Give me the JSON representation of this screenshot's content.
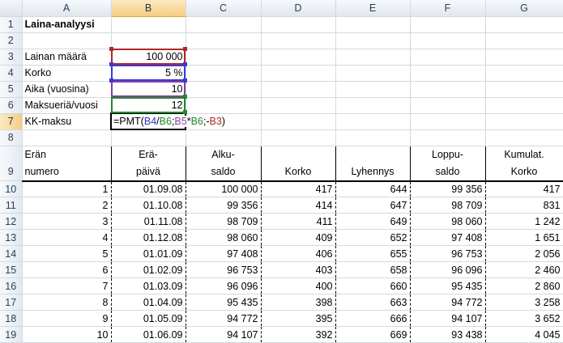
{
  "columns": [
    "A",
    "B",
    "C",
    "D",
    "E",
    "F",
    "G"
  ],
  "selected_column": "B",
  "rows": {
    "r1": {
      "num": "1",
      "a": "Laina-analyysi"
    },
    "r2": {
      "num": "2"
    },
    "r3": {
      "num": "3",
      "a": "Lainan määrä",
      "b": "100 000"
    },
    "r4": {
      "num": "4",
      "a": "Korko",
      "b": "5 %"
    },
    "r5": {
      "num": "5",
      "a": "Aika (vuosina)",
      "b": "10"
    },
    "r6": {
      "num": "6",
      "a": "Maksueriä/vuosi",
      "b": "12"
    },
    "r7": {
      "num": "7",
      "a": "KK-maksu"
    },
    "r8": {
      "num": "8"
    }
  },
  "formula": {
    "prefix": "=PMT(",
    "ref1": "B4",
    "sep1": "/",
    "ref2": "B6",
    "sep2": ";",
    "ref3": "B5",
    "sep3": "*",
    "ref4": "B6",
    "sep4": ";-",
    "ref5": "B3",
    "suffix": ")"
  },
  "table_header": {
    "num": "9",
    "a1": "Erän",
    "a2": "numero",
    "b1": "Erä-",
    "b2": "päivä",
    "c1": "Alku-",
    "c2": "saldo",
    "d2": "Korko",
    "e2": "Lyhennys",
    "f1": "Loppu-",
    "f2": "saldo",
    "g1": "Kumulat.",
    "g2": "Korko"
  },
  "data_rows": [
    {
      "num": "10",
      "era": "1",
      "paiva": "01.09.08",
      "alku": "100 000",
      "korko": "417",
      "lyh": "644",
      "loppu": "99 356",
      "kum": "417"
    },
    {
      "num": "11",
      "era": "2",
      "paiva": "01.10.08",
      "alku": "99 356",
      "korko": "414",
      "lyh": "647",
      "loppu": "98 709",
      "kum": "831"
    },
    {
      "num": "12",
      "era": "3",
      "paiva": "01.11.08",
      "alku": "98 709",
      "korko": "411",
      "lyh": "649",
      "loppu": "98 060",
      "kum": "1 242"
    },
    {
      "num": "13",
      "era": "4",
      "paiva": "01.12.08",
      "alku": "98 060",
      "korko": "409",
      "lyh": "652",
      "loppu": "97 408",
      "kum": "1 651"
    },
    {
      "num": "14",
      "era": "5",
      "paiva": "01.01.09",
      "alku": "97 408",
      "korko": "406",
      "lyh": "655",
      "loppu": "96 753",
      "kum": "2 056"
    },
    {
      "num": "15",
      "era": "6",
      "paiva": "01.02.09",
      "alku": "96 753",
      "korko": "403",
      "lyh": "658",
      "loppu": "96 096",
      "kum": "2 460"
    },
    {
      "num": "16",
      "era": "7",
      "paiva": "01.03.09",
      "alku": "96 096",
      "korko": "400",
      "lyh": "660",
      "loppu": "95 435",
      "kum": "2 860"
    },
    {
      "num": "17",
      "era": "8",
      "paiva": "01.04.09",
      "alku": "95 435",
      "korko": "398",
      "lyh": "663",
      "loppu": "94 772",
      "kum": "3 258"
    },
    {
      "num": "18",
      "era": "9",
      "paiva": "01.05.09",
      "alku": "94 772",
      "korko": "395",
      "lyh": "666",
      "loppu": "94 107",
      "kum": "3 652"
    },
    {
      "num": "19",
      "era": "10",
      "paiva": "01.06.09",
      "alku": "94 107",
      "korko": "392",
      "lyh": "669",
      "loppu": "93 438",
      "kum": "4 045"
    }
  ]
}
